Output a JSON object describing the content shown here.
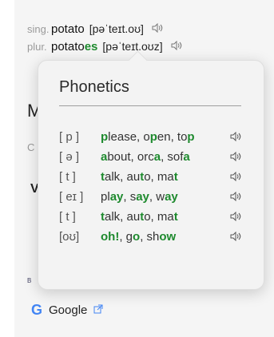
{
  "entry": {
    "sing_label": "sing.",
    "sing_word": "potato",
    "sing_ipa": "[pəˈteɪt.oʊ]",
    "plur_label": "plur.",
    "plur_base": "potato",
    "plur_suffix": "es",
    "plur_ipa": "[pəˈteɪt.oʊz]"
  },
  "background": {
    "m": "M",
    "c": "C",
    "v": "V",
    "b": "B"
  },
  "popover": {
    "title": "Phonetics",
    "rows": [
      {
        "symbol": "[ p ]",
        "examples": [
          {
            "w": "please",
            "h": "p",
            "pos": "start"
          },
          {
            "w": "open",
            "h": "p",
            "pos": "mid"
          },
          {
            "w": "top",
            "h": "p",
            "pos": "end"
          }
        ]
      },
      {
        "symbol": "[ ə ]",
        "examples": [
          {
            "w": "about",
            "h": "a",
            "pos": "start"
          },
          {
            "w": "orca",
            "h": "a",
            "pos": "end"
          },
          {
            "w": "sofa",
            "h": "a",
            "pos": "end"
          }
        ]
      },
      {
        "symbol": "[ t ]",
        "examples": [
          {
            "w": "talk",
            "h": "t",
            "pos": "start"
          },
          {
            "w": "auto",
            "h": "t",
            "pos": "mid"
          },
          {
            "w": "mat",
            "h": "t",
            "pos": "end"
          }
        ]
      },
      {
        "symbol": "[ eɪ ]",
        "examples": [
          {
            "w": "play",
            "h": "ay",
            "pos": "end"
          },
          {
            "w": "say",
            "h": "ay",
            "pos": "end"
          },
          {
            "w": "way",
            "h": "ay",
            "pos": "end"
          }
        ]
      },
      {
        "symbol": "[ t ]",
        "examples": [
          {
            "w": "talk",
            "h": "t",
            "pos": "start"
          },
          {
            "w": "auto",
            "h": "t",
            "pos": "mid"
          },
          {
            "w": "mat",
            "h": "t",
            "pos": "end"
          }
        ]
      },
      {
        "symbol": "[oʊ]",
        "examples": [
          {
            "w": "oh!",
            "h": "oh!",
            "pos": "all"
          },
          {
            "w": "go",
            "h": "o",
            "pos": "end"
          },
          {
            "w": "show",
            "h": "ow",
            "pos": "end"
          }
        ]
      }
    ]
  },
  "google": {
    "logo": "G",
    "label": "Google"
  },
  "icons": {
    "speaker": "speaker-icon",
    "external": "external-link-icon"
  },
  "colors": {
    "highlight": "#1e8a2e",
    "google_blue": "#4285f4"
  }
}
